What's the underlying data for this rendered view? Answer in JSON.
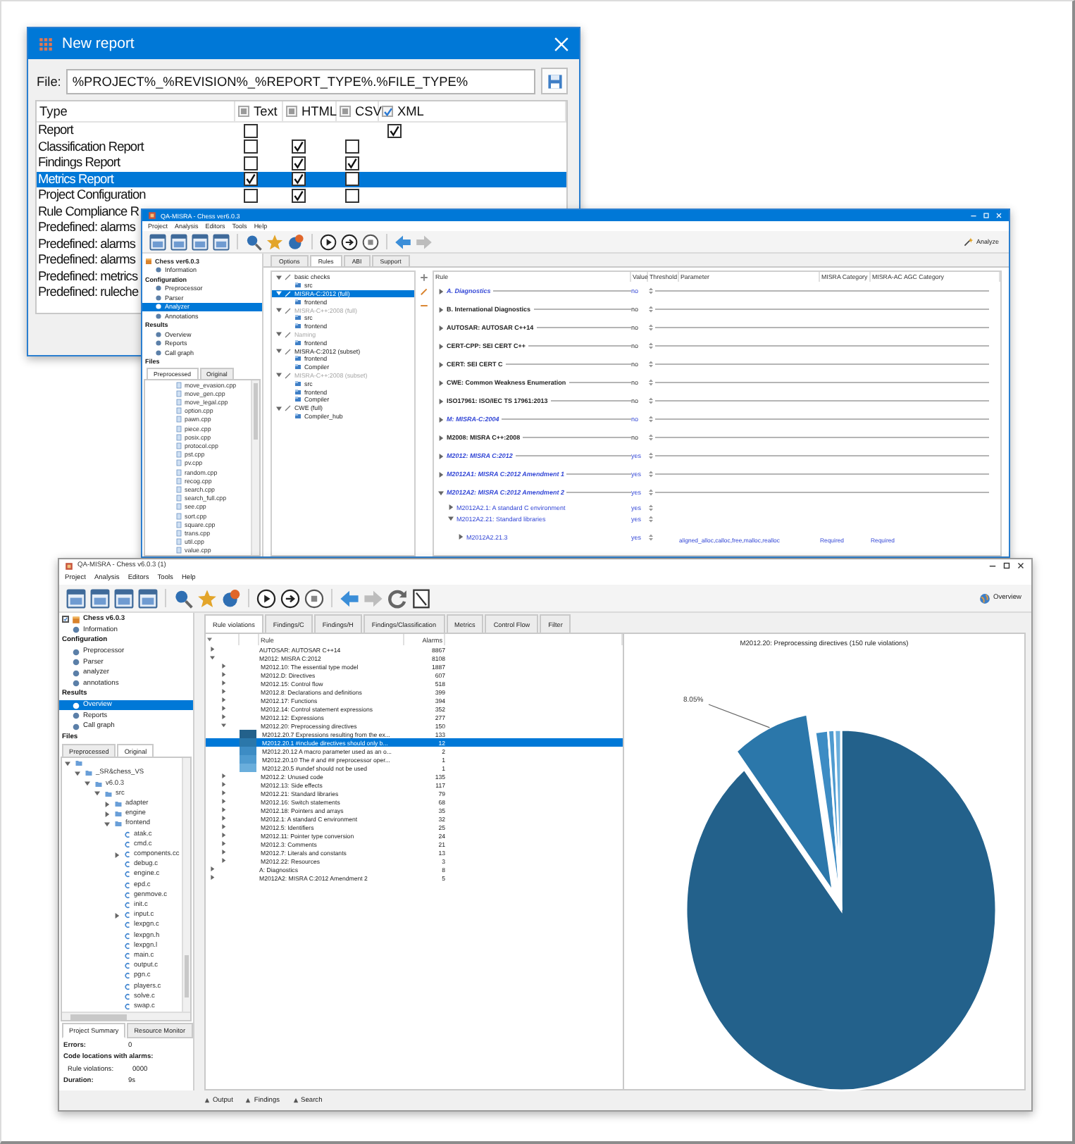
{
  "dialog": {
    "title": "New report",
    "file_label": "File:",
    "file_value": "%PROJECT%_%REVISION%_%REPORT_TYPE%.%FILE_TYPE%",
    "columns": [
      {
        "label": "Type"
      },
      {
        "label": "Text",
        "checked": false
      },
      {
        "label": "HTML",
        "checked": false
      },
      {
        "label": "CSV",
        "checked": false
      },
      {
        "label": "XML",
        "checked": true
      }
    ],
    "rows": [
      {
        "label": "Report",
        "selected": false,
        "checks": {
          "text": false,
          "xml": true
        }
      },
      {
        "label": "Classification Report",
        "selected": false,
        "checks": {
          "text": false,
          "html": true,
          "csv": false
        }
      },
      {
        "label": "Findings Report",
        "selected": false,
        "checks": {
          "text": false,
          "html": true,
          "csv": true
        }
      },
      {
        "label": "Metrics Report",
        "selected": true,
        "checks": {
          "text": true,
          "html": true,
          "csv": false
        }
      },
      {
        "label": "Project Configuration",
        "selected": false,
        "checks": {
          "text": false,
          "html": true,
          "csv": false
        }
      },
      {
        "label": "Rule Compliance R",
        "selected": false
      },
      {
        "label": "Predefined: alarms",
        "selected": false
      },
      {
        "label": "Predefined: alarms",
        "selected": false
      },
      {
        "label": "Predefined: alarms",
        "selected": false
      },
      {
        "label": "Predefined: metrics",
        "selected": false
      },
      {
        "label": "Predefined: ruleche",
        "selected": false
      }
    ]
  },
  "analysis_window": {
    "title": "QA-MISRA - Chess ver6.0.3",
    "menu": [
      "Project",
      "Analysis",
      "Editors",
      "Tools",
      "Help"
    ],
    "analyze_button": "Analyze",
    "nav": [
      {
        "label": "Chess ver6.0.3",
        "kind": "project",
        "selected": false,
        "children": [
          {
            "label": "Information",
            "selected": false
          }
        ]
      },
      {
        "label": "Configuration",
        "kind": "section",
        "children": [
          {
            "label": "Preprocessor",
            "selected": false
          },
          {
            "label": "Parser",
            "selected": false
          },
          {
            "label": "Analyzer",
            "selected": true
          },
          {
            "label": "Annotations",
            "selected": false
          }
        ]
      },
      {
        "label": "Results",
        "kind": "section",
        "children": [
          {
            "label": "Overview",
            "selected": false
          },
          {
            "label": "Reports",
            "selected": false
          },
          {
            "label": "Call graph",
            "selected": false
          }
        ]
      },
      {
        "label": "Files",
        "kind": "section"
      }
    ],
    "file_tabs": [
      {
        "label": "Preprocessed",
        "selected": true
      },
      {
        "label": "Original",
        "selected": false
      }
    ],
    "files": [
      "move_evasion.cpp",
      "move_gen.cpp",
      "move_legal.cpp",
      "option.cpp",
      "pawn.cpp",
      "piece.cpp",
      "posix.cpp",
      "protocol.cpp",
      "pst.cpp",
      "pv.cpp",
      "random.cpp",
      "recog.cpp",
      "search.cpp",
      "search_full.cpp",
      "see.cpp",
      "sort.cpp",
      "square.cpp",
      "trans.cpp",
      "util.cpp",
      "value.cpp"
    ],
    "tabs": [
      {
        "label": "Options",
        "selected": false
      },
      {
        "label": "Rules",
        "selected": true
      },
      {
        "label": "ABI",
        "selected": false
      },
      {
        "label": "Support",
        "selected": false
      }
    ],
    "rule_sets": [
      {
        "label": "basic checks",
        "selected": false,
        "disabled": false,
        "expanded": true,
        "children": [
          "src"
        ]
      },
      {
        "label": "MISRA-C:2012 (full)",
        "selected": true,
        "disabled": false,
        "expanded": true,
        "children": [
          "frontend"
        ]
      },
      {
        "label": "MISRA-C++:2008 (full)",
        "selected": false,
        "disabled": true,
        "expanded": true,
        "children": [
          "src",
          "frontend"
        ]
      },
      {
        "label": "Naming",
        "selected": false,
        "disabled": true,
        "expanded": true,
        "children": [
          "frontend"
        ]
      },
      {
        "label": "MISRA-C:2012 (subset)",
        "selected": false,
        "disabled": false,
        "expanded": true,
        "children": [
          "frontend",
          "Compiler"
        ]
      },
      {
        "label": "MISRA-C++:2008 (subset)",
        "selected": false,
        "disabled": true,
        "expanded": true,
        "children": [
          "src",
          "frontend",
          "Compiler"
        ]
      },
      {
        "label": "CWE (full)",
        "selected": false,
        "disabled": false,
        "expanded": true,
        "children": [
          "Compiler_hub"
        ]
      }
    ],
    "rules_columns": [
      "Rule",
      "Value",
      "Threshold",
      "Parameter",
      "MISRA Category",
      "MISRA-AC AGC Category"
    ],
    "rules": [
      {
        "rule": "A. Diagnostics",
        "value": "no",
        "active": true,
        "expanded": false
      },
      {
        "rule": "B. International Diagnostics",
        "value": "no",
        "active": false,
        "expanded": false
      },
      {
        "rule": "AUTOSAR: AUTOSAR C++14",
        "value": "no",
        "active": false,
        "expanded": false
      },
      {
        "rule": "CERT-CPP: SEI CERT C++",
        "value": "no",
        "active": false,
        "expanded": false
      },
      {
        "rule": "CERT: SEI CERT C",
        "value": "no",
        "active": false,
        "expanded": false
      },
      {
        "rule": "CWE: Common Weakness Enumeration",
        "value": "no",
        "active": false,
        "expanded": false
      },
      {
        "rule": "ISO17961: ISO/IEC TS 17961:2013",
        "value": "no",
        "active": false,
        "expanded": false
      },
      {
        "rule": "M: MISRA-C:2004",
        "value": "no",
        "active": true,
        "expanded": false
      },
      {
        "rule": "M2008: MISRA C++:2008",
        "value": "no",
        "active": false,
        "expanded": false
      },
      {
        "rule": "M2012: MISRA C:2012",
        "value": "yes",
        "active": true,
        "expanded": false
      },
      {
        "rule": "M2012A1: MISRA C:2012 Amendment 1",
        "value": "yes",
        "active": true,
        "expanded": false
      },
      {
        "rule": "M2012A2: MISRA C:2012 Amendment 2",
        "value": "yes",
        "active": true,
        "expanded": true,
        "children": [
          {
            "rule": "M2012A2.1: A standard C environment",
            "value": "yes",
            "active": true,
            "expanded": false
          },
          {
            "rule": "M2012A2.21: Standard libraries",
            "value": "yes",
            "active": true,
            "expanded": true,
            "children": [
              {
                "rule": "M2012A2.21.3",
                "value": "yes",
                "active": true,
                "expanded": false,
                "parameter": "aligned_alloc,calloc,free,malloc,realloc",
                "misra_category": "Required",
                "agc_category": "Required"
              }
            ]
          }
        ]
      }
    ]
  },
  "overview_window": {
    "title": "QA-MISRA - Chess v6.0.3 (1)",
    "menu": [
      "Project",
      "Analysis",
      "Editors",
      "Tools",
      "Help"
    ],
    "overview_button": "Overview",
    "nav": [
      {
        "label": "Chess v6.0.3",
        "kind": "project",
        "selected": false,
        "checked": true,
        "children": [
          {
            "label": "Information",
            "selected": false
          }
        ]
      },
      {
        "label": "Configuration",
        "kind": "section",
        "children": [
          {
            "label": "Preprocessor",
            "selected": false
          },
          {
            "label": "Parser",
            "selected": false
          },
          {
            "label": "analyzer",
            "selected": false
          },
          {
            "label": "annotations",
            "selected": false
          }
        ]
      },
      {
        "label": "Results",
        "kind": "section",
        "children": [
          {
            "label": "Overview",
            "selected": true
          },
          {
            "label": "Reports",
            "selected": false
          },
          {
            "label": "Call graph",
            "selected": false
          }
        ]
      },
      {
        "label": "Files",
        "kind": "section"
      }
    ],
    "file_tabs": [
      {
        "label": "Preprocessed",
        "selected": false
      },
      {
        "label": "Original",
        "selected": true
      }
    ],
    "file_tree": [
      {
        "kind": "folder",
        "expanded": true,
        "children": [
          {
            "label": "_SR&chess_VS",
            "kind": "folder",
            "expanded": true,
            "children": [
              {
                "label": "v6.0.3",
                "kind": "folder",
                "expanded": true,
                "children": [
                  {
                    "label": "src",
                    "kind": "folder",
                    "expanded": true,
                    "children": [
                      {
                        "label": "adapter",
                        "kind": "folder",
                        "expanded": false
                      },
                      {
                        "label": "engine",
                        "kind": "folder",
                        "expanded": false
                      },
                      {
                        "label": "frontend",
                        "kind": "folder",
                        "expanded": true,
                        "children": [
                          {
                            "label": "atak.c",
                            "kind": "file"
                          },
                          {
                            "label": "cmd.c",
                            "kind": "file"
                          },
                          {
                            "label": "components.cc",
                            "kind": "file",
                            "expanded": false
                          },
                          {
                            "label": "debug.c",
                            "kind": "file"
                          },
                          {
                            "label": "engine.c",
                            "kind": "file"
                          },
                          {
                            "label": "epd.c",
                            "kind": "file"
                          },
                          {
                            "label": "genmove.c",
                            "kind": "file"
                          },
                          {
                            "label": "init.c",
                            "kind": "file"
                          },
                          {
                            "label": "input.c",
                            "kind": "file",
                            "expanded": false
                          },
                          {
                            "label": "lexpgn.c",
                            "kind": "file"
                          },
                          {
                            "label": "lexpgn.h",
                            "kind": "file"
                          },
                          {
                            "label": "lexpgn.l",
                            "kind": "file"
                          },
                          {
                            "label": "main.c",
                            "kind": "file"
                          },
                          {
                            "label": "output.c",
                            "kind": "file"
                          },
                          {
                            "label": "pgn.c",
                            "kind": "file"
                          },
                          {
                            "label": "players.c",
                            "kind": "file"
                          },
                          {
                            "label": "solve.c",
                            "kind": "file"
                          },
                          {
                            "label": "swap.c",
                            "kind": "file"
                          }
                        ]
                      }
                    ]
                  }
                ]
              }
            ]
          }
        ]
      }
    ],
    "summary_tabs": [
      {
        "label": "Project Summary",
        "selected": true
      },
      {
        "label": "Resource Monitor",
        "selected": false
      }
    ],
    "summary": [
      {
        "label": "Errors:",
        "value": "0",
        "kind": "bold"
      },
      {
        "label": "Code locations with alarms:",
        "kind": "bold"
      },
      {
        "label": "Rule violations:",
        "value": "0000",
        "kind": "plain"
      },
      {
        "label": "Duration:",
        "value": "9s",
        "kind": "bold"
      }
    ],
    "tabs": [
      {
        "label": "Rule violations",
        "selected": true
      },
      {
        "label": "Findings/C",
        "selected": false
      },
      {
        "label": "Findings/H",
        "selected": false
      },
      {
        "label": "Findings/Classification",
        "selected": false
      },
      {
        "label": "Metrics",
        "selected": false
      },
      {
        "label": "Control Flow",
        "selected": false
      },
      {
        "label": "Filter",
        "selected": false
      }
    ],
    "table": {
      "columns": [
        "Rule",
        "Alarms"
      ],
      "rows": [
        {
          "rule": "AUTOSAR: AUTOSAR C++14",
          "alarms": "8867",
          "expanded": false,
          "selected": false
        },
        {
          "rule": "M2012: MISRA C:2012",
          "alarms": "8108",
          "expanded": true,
          "selected": false,
          "children": [
            {
              "rule": "M2012.10: The essential type model",
              "alarms": "1887",
              "expanded": false,
              "selected": false
            },
            {
              "rule": "M2012.D: Directives",
              "alarms": "607",
              "expanded": false,
              "selected": false
            },
            {
              "rule": "M2012.15: Control flow",
              "alarms": "518",
              "expanded": false,
              "selected": false
            },
            {
              "rule": "M2012.8: Declarations and definitions",
              "alarms": "399",
              "expanded": false,
              "selected": false
            },
            {
              "rule": "M2012.17: Functions",
              "alarms": "394",
              "expanded": false,
              "selected": false
            },
            {
              "rule": "M2012.14: Control statement expressions",
              "alarms": "352",
              "expanded": false,
              "selected": false
            },
            {
              "rule": "M2012.12: Expressions",
              "alarms": "277",
              "expanded": false,
              "selected": false
            },
            {
              "rule": "M2012.20: Preprocessing directives",
              "alarms": "150",
              "expanded": true,
              "selected": false,
              "children": [
                {
                  "rule": "M2012.20.7 Expressions resulting from the ex...",
                  "alarms": "133",
                  "selected": false,
                  "color": "#23618b"
                },
                {
                  "rule": "M2012.20.1 #include directives should only b...",
                  "alarms": "12",
                  "selected": true,
                  "color": "#2b77aa"
                },
                {
                  "rule": "M2012.20.12 A macro parameter used as an o...",
                  "alarms": "2",
                  "selected": false,
                  "color": "#3d8cc4"
                },
                {
                  "rule": "M2012.20.10 The # and ## preprocessor oper...",
                  "alarms": "1",
                  "selected": false,
                  "color": "#4f9bd0"
                },
                {
                  "rule": "M2012.20.5 #undef should not be used",
                  "alarms": "1",
                  "selected": false,
                  "color": "#6aaedc"
                }
              ]
            },
            {
              "rule": "M2012.2: Unused code",
              "alarms": "135",
              "expanded": false,
              "selected": false
            },
            {
              "rule": "M2012.13: Side effects",
              "alarms": "117",
              "expanded": false,
              "selected": false
            },
            {
              "rule": "M2012.21: Standard libraries",
              "alarms": "79",
              "expanded": false,
              "selected": false
            },
            {
              "rule": "M2012.16: Switch statements",
              "alarms": "68",
              "expanded": false,
              "selected": false
            },
            {
              "rule": "M2012.18: Pointers and arrays",
              "alarms": "35",
              "expanded": false,
              "selected": false
            },
            {
              "rule": "M2012.1: A standard C environment",
              "alarms": "32",
              "expanded": false,
              "selected": false
            },
            {
              "rule": "M2012.5: Identifiers",
              "alarms": "25",
              "expanded": false,
              "selected": false
            },
            {
              "rule": "M2012.11: Pointer type conversion",
              "alarms": "24",
              "expanded": false,
              "selected": false
            },
            {
              "rule": "M2012.3: Comments",
              "alarms": "21",
              "expanded": false,
              "selected": false
            },
            {
              "rule": "M2012.7: Literals and constants",
              "alarms": "13",
              "expanded": false,
              "selected": false
            },
            {
              "rule": "M2012.22: Resources",
              "alarms": "3",
              "expanded": false,
              "selected": false
            }
          ]
        },
        {
          "rule": "A: Diagnostics",
          "alarms": "8",
          "expanded": false,
          "selected": false
        },
        {
          "rule": "M2012A2: MISRA C:2012 Amendment 2",
          "alarms": "5",
          "expanded": false,
          "selected": false
        }
      ]
    },
    "chart": {
      "title": "M2012.20: Preprocessing directives (150 rule violations)",
      "slice_label": "8.05%"
    },
    "status_bar": [
      "Output",
      "Findings",
      "Search"
    ]
  }
}
